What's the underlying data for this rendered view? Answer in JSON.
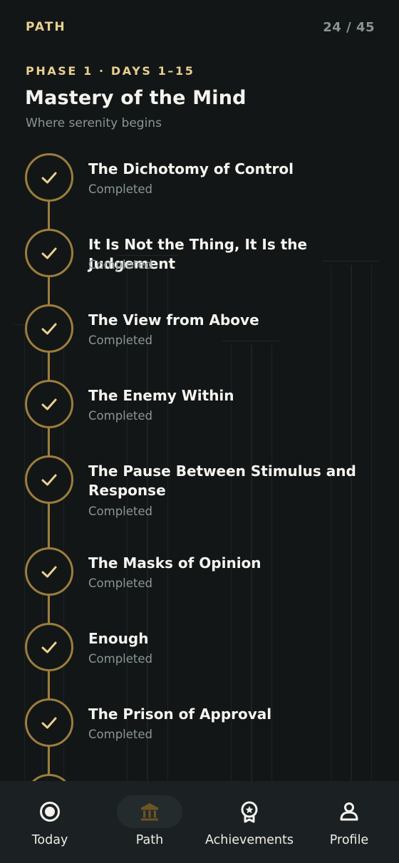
{
  "header": {
    "title": "PATH",
    "progress": "24 / 45"
  },
  "phase": {
    "label": "PHASE 1 · DAYS 1–15",
    "title": "Mastery of the Mind",
    "subtitle": "Where serenity begins"
  },
  "lessons": [
    {
      "title": "The Dichotomy of Control",
      "status": "Completed"
    },
    {
      "title": "It Is Not the Thing, It Is the Judgement",
      "status": "Completed"
    },
    {
      "title": "The View from Above",
      "status": "Completed"
    },
    {
      "title": "The Enemy Within",
      "status": "Completed"
    },
    {
      "title": "The Pause Between Stimulus and Response",
      "status": "Completed"
    },
    {
      "title": "The Masks of Opinion",
      "status": "Completed"
    },
    {
      "title": "Enough",
      "status": "Completed"
    },
    {
      "title": "The Prison of Approval",
      "status": "Completed"
    }
  ],
  "nav": {
    "items": [
      {
        "label": "Today",
        "icon": "target-icon"
      },
      {
        "label": "Path",
        "icon": "temple-icon",
        "active": true
      },
      {
        "label": "Achievements",
        "icon": "medal-icon"
      },
      {
        "label": "Profile",
        "icon": "person-icon"
      }
    ]
  },
  "colors": {
    "accent": "#e9cf8f",
    "gold": "#9c7d3c",
    "background": "#121617",
    "nav_bg": "#1b2122",
    "muted": "#8b9594"
  }
}
